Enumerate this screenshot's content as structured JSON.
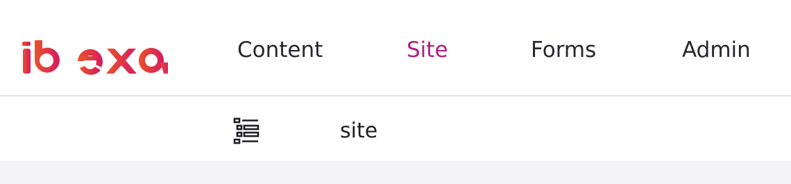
{
  "header": {
    "logo": {
      "text": "ibexa",
      "gradient_start": "#e8522b",
      "gradient_end": "#d81b60"
    },
    "nav": [
      {
        "label": "Content",
        "active": false
      },
      {
        "label": "Site",
        "active": true
      },
      {
        "label": "Forms",
        "active": false
      },
      {
        "label": "Admin",
        "active": false
      }
    ]
  },
  "subheader": {
    "tree_toggle_icon": "content-tree-list-icon",
    "breadcrumb": "site"
  },
  "colors": {
    "active_nav": "#b01f7a",
    "text": "#26262e",
    "divider": "#e9e1dc",
    "page_background": "#f4f4f6"
  }
}
